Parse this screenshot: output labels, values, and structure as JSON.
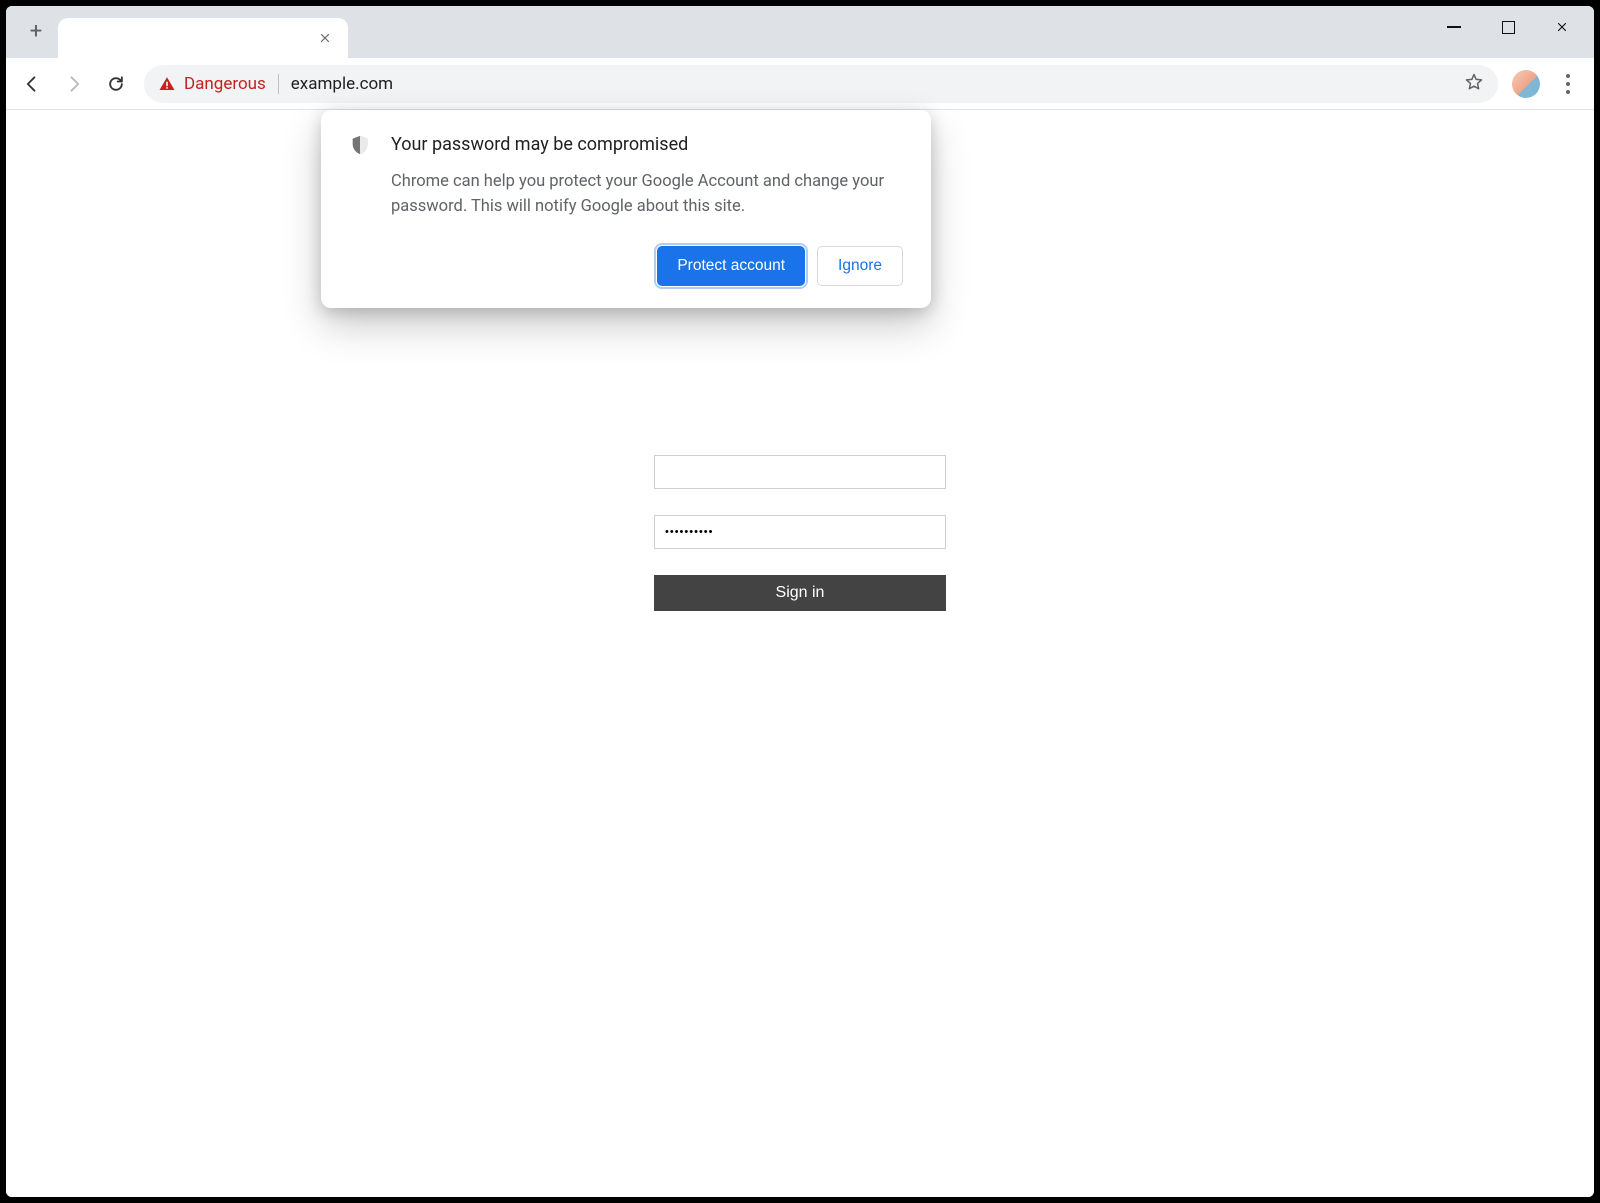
{
  "omnibox": {
    "security_label": "Dangerous",
    "url": "example.com"
  },
  "popup": {
    "title": "Your password may be compromised",
    "body": "Chrome can help you protect your Google Account and change your password. This will notify Google about this site.",
    "primary": "Protect account",
    "secondary": "Ignore"
  },
  "form": {
    "username_value": "",
    "password_value": "••••••••••",
    "signin_label": "Sign in"
  },
  "colors": {
    "danger": "#c5221f",
    "primary": "#1a73e8",
    "toolbar_bg": "#dee1e6",
    "omnibox_bg": "#f1f3f4",
    "text": "#202124",
    "muted": "#5f6368",
    "signin_bg": "#434343"
  }
}
